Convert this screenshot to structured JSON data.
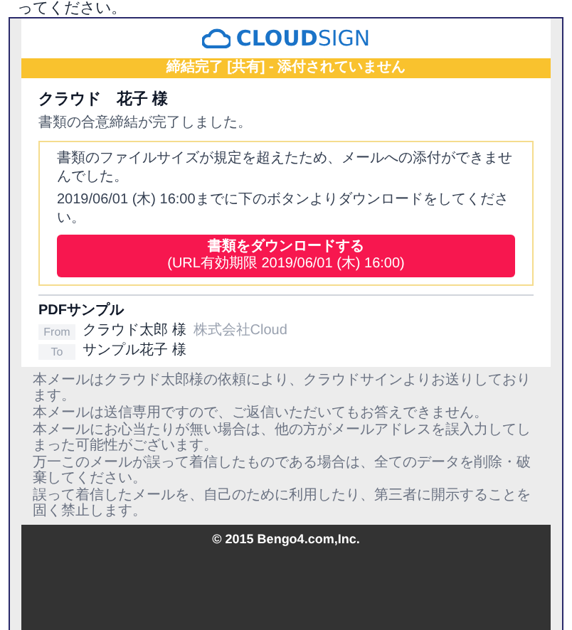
{
  "caption": "ってください。",
  "logo": {
    "text": "**CLOUD**SIGN"
  },
  "banner": "締結完了 [共有] - 添付されていません",
  "greeting": "クラウド　花子 様",
  "message": "書類の合意締結が完了しました。",
  "notice": {
    "paragraphs": [
      "書類のファイルサイズが規定を超えたため、メールへの添付ができませんでした。",
      "2019/06/01 (木) 16:00までに下のボタンよりダウンロードをしてください。"
    ],
    "button": {
      "label": "書類をダウンロードする",
      "sublabel": "(URL有効期限 2019/06/01 (木) 16:00)"
    }
  },
  "document": {
    "title": "PDFサンプル",
    "parties": [
      {
        "tag": "From",
        "name": "クラウド太郎 様",
        "company": "株式会社Cloud"
      },
      {
        "tag": "To",
        "name": "サンプル花子 様"
      }
    ]
  },
  "footer_notes": [
    "本メールはクラウド太郎様の依頼により、クラウドサインよりお送りしております。",
    "本メールは送信専用ですので、ご返信いただいてもお答えできません。",
    "本メールにお心当たりが無い場合は、他の方がメールアドレスを誤入力してしまった可能性がございます。",
    "万一このメールが誤って着信したものである場合は、全てのデータを削除・破棄してください。",
    "誤って着信したメールを、自己のために利用したり、第三者に開示することを固く禁止します。"
  ],
  "copyright": "© 2015 Bengo4.com,Inc."
}
